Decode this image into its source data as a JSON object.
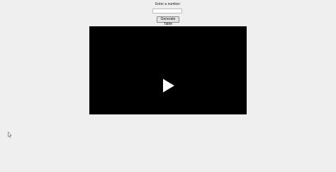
{
  "form": {
    "prompt_label": "Enter a number:",
    "input_value": "",
    "generate_button_label": "Generate Table"
  },
  "video": {
    "state": "paused",
    "play_icon": "play-icon"
  },
  "cursor": {
    "icon": "mouse-pointer-icon"
  },
  "colors": {
    "page_background": "#efefef",
    "video_background": "#000000",
    "play_icon": "#ffffff"
  }
}
